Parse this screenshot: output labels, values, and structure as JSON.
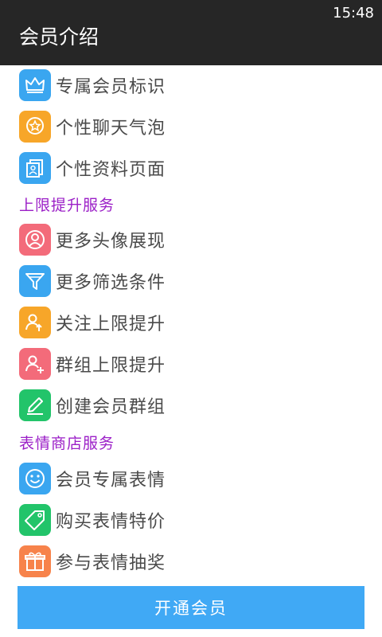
{
  "status_bar": {
    "time": "15:48"
  },
  "header": {
    "title": "会员介绍"
  },
  "items_group1": [
    {
      "label": "专属会员标识",
      "icon": "crown-icon",
      "color": "#3aa6f0"
    },
    {
      "label": "个性聊天气泡",
      "icon": "bubble-star-icon",
      "color": "#f7a629"
    },
    {
      "label": "个性资料页面",
      "icon": "profile-cards-icon",
      "color": "#3aa6f0"
    }
  ],
  "section2": {
    "title": "上限提升服务"
  },
  "items_group2": [
    {
      "label": "更多头像展现",
      "icon": "avatar-icon",
      "color": "#f36b7a"
    },
    {
      "label": "更多筛选条件",
      "icon": "filter-icon",
      "color": "#3aa6f0"
    },
    {
      "label": "关注上限提升",
      "icon": "follow-up-icon",
      "color": "#f7a629"
    },
    {
      "label": "群组上限提升",
      "icon": "group-add-icon",
      "color": "#f36b7a"
    },
    {
      "label": "创建会员群组",
      "icon": "pencil-icon",
      "color": "#22c46a"
    }
  ],
  "section3": {
    "title": "表情商店服务"
  },
  "items_group3": [
    {
      "label": "会员专属表情",
      "icon": "smiley-icon",
      "color": "#3aa6f0"
    },
    {
      "label": "购买表情特价",
      "icon": "price-tag-icon",
      "color": "#22c46a"
    },
    {
      "label": "参与表情抽奖",
      "icon": "gift-icon",
      "color": "#f7834b"
    }
  ],
  "footer": {
    "button_label": "开通会员"
  }
}
